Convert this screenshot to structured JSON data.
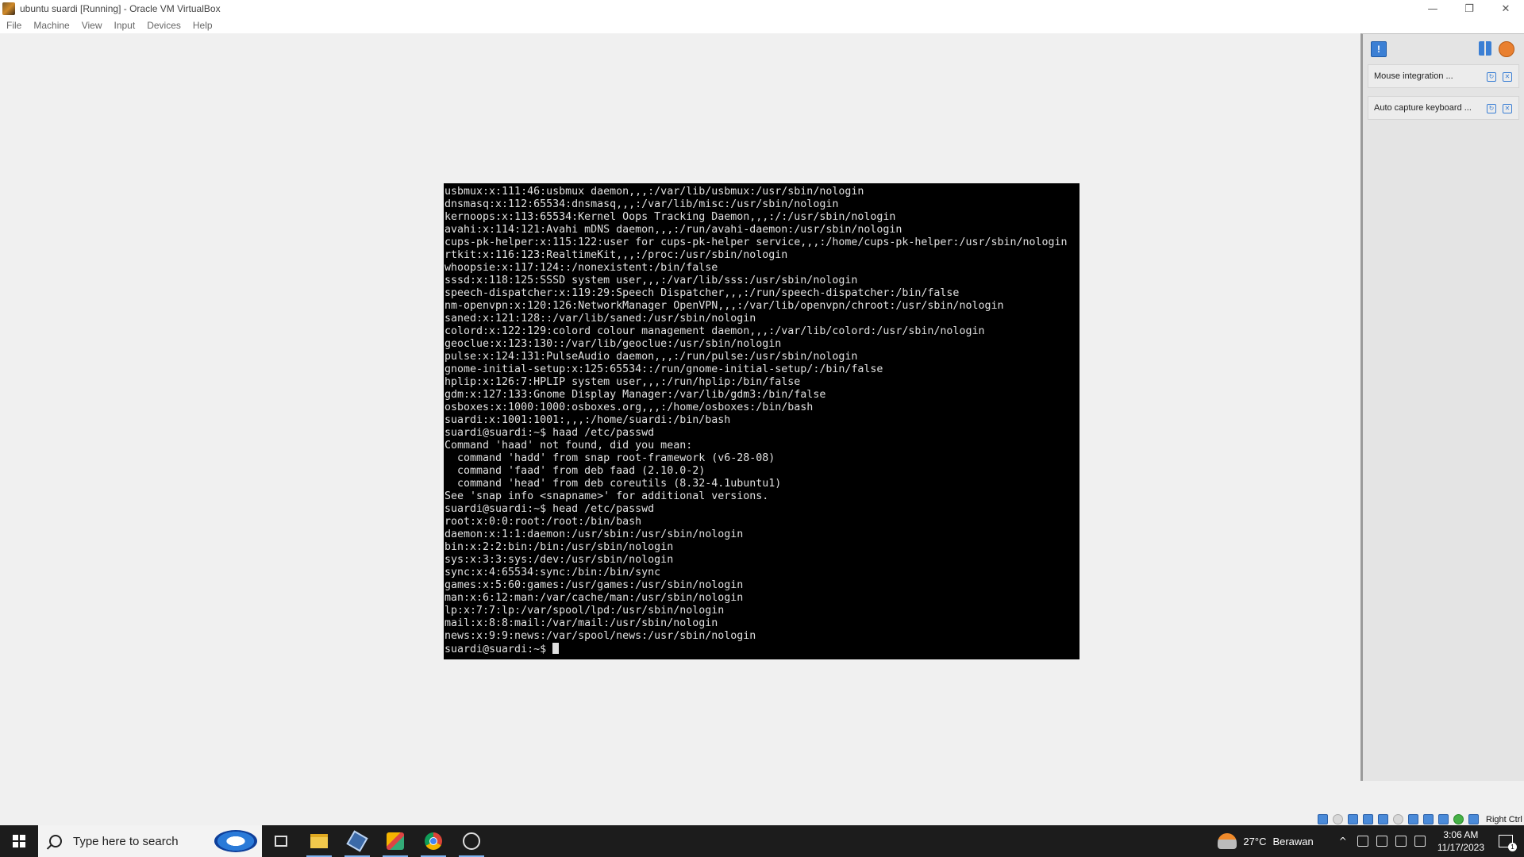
{
  "window": {
    "title": "ubuntu suardi [Running] - Oracle VM VirtualBox",
    "controls": {
      "minimize": "—",
      "restore": "❐",
      "close": "✕"
    }
  },
  "menu": [
    {
      "label": "File"
    },
    {
      "label": "Machine"
    },
    {
      "label": "View"
    },
    {
      "label": "Input"
    },
    {
      "label": "Devices"
    },
    {
      "label": "Help"
    }
  ],
  "terminal": {
    "lines": [
      "usbmux:x:111:46:usbmux daemon,,,:/var/lib/usbmux:/usr/sbin/nologin",
      "dnsmasq:x:112:65534:dnsmasq,,,:/var/lib/misc:/usr/sbin/nologin",
      "kernoops:x:113:65534:Kernel Oops Tracking Daemon,,,:/:/usr/sbin/nologin",
      "avahi:x:114:121:Avahi mDNS daemon,,,:/run/avahi-daemon:/usr/sbin/nologin",
      "cups-pk-helper:x:115:122:user for cups-pk-helper service,,,:/home/cups-pk-helper:/usr/sbin/nologin",
      "rtkit:x:116:123:RealtimeKit,,,:/proc:/usr/sbin/nologin",
      "whoopsie:x:117:124::/nonexistent:/bin/false",
      "sssd:x:118:125:SSSD system user,,,:/var/lib/sss:/usr/sbin/nologin",
      "speech-dispatcher:x:119:29:Speech Dispatcher,,,:/run/speech-dispatcher:/bin/false",
      "nm-openvpn:x:120:126:NetworkManager OpenVPN,,,:/var/lib/openvpn/chroot:/usr/sbin/nologin",
      "saned:x:121:128::/var/lib/saned:/usr/sbin/nologin",
      "colord:x:122:129:colord colour management daemon,,,:/var/lib/colord:/usr/sbin/nologin",
      "geoclue:x:123:130::/var/lib/geoclue:/usr/sbin/nologin",
      "pulse:x:124:131:PulseAudio daemon,,,:/run/pulse:/usr/sbin/nologin",
      "gnome-initial-setup:x:125:65534::/run/gnome-initial-setup/:/bin/false",
      "hplip:x:126:7:HPLIP system user,,,:/run/hplip:/bin/false",
      "gdm:x:127:133:Gnome Display Manager:/var/lib/gdm3:/bin/false",
      "osboxes:x:1000:1000:osboxes.org,,,:/home/osboxes:/bin/bash",
      "suardi:x:1001:1001:,,,:/home/suardi:/bin/bash",
      "suardi@suardi:~$ haad /etc/passwd",
      "Command 'haad' not found, did you mean:",
      "  command 'hadd' from snap root-framework (v6-28-08)",
      "  command 'faad' from deb faad (2.10.0-2)",
      "  command 'head' from deb coreutils (8.32-4.1ubuntu1)",
      "See 'snap info <snapname>' for additional versions.",
      "suardi@suardi:~$ head /etc/passwd",
      "root:x:0:0:root:/root:/bin/bash",
      "daemon:x:1:1:daemon:/usr/sbin:/usr/sbin/nologin",
      "bin:x:2:2:bin:/bin:/usr/sbin/nologin",
      "sys:x:3:3:sys:/dev:/usr/sbin/nologin",
      "sync:x:4:65534:sync:/bin:/bin/sync",
      "games:x:5:60:games:/usr/games:/usr/sbin/nologin",
      "man:x:6:12:man:/var/cache/man:/usr/sbin/nologin",
      "lp:x:7:7:lp:/var/spool/lpd:/usr/sbin/nologin",
      "mail:x:8:8:mail:/var/mail:/usr/sbin/nologin",
      "news:x:9:9:news:/var/spool/news:/usr/sbin/nologin"
    ],
    "prompt": "suardi@suardi:~$ "
  },
  "notifications": {
    "items": [
      {
        "text": "Mouse integration ..."
      },
      {
        "text": "Auto capture keyboard ..."
      }
    ]
  },
  "statusbar": {
    "host_key": "Right Ctrl"
  },
  "taskbar": {
    "search_placeholder": "Type here to search",
    "weather_temp": "27°C",
    "weather_desc": "Berawan",
    "time": "3:06 AM",
    "date": "11/17/2023",
    "notification_count": "1"
  },
  "colors": {
    "terminal_bg": "#000000",
    "terminal_fg": "#e0e0e0",
    "taskbar_bg": "#1c1c1c",
    "accent": "#3b7fd4"
  }
}
